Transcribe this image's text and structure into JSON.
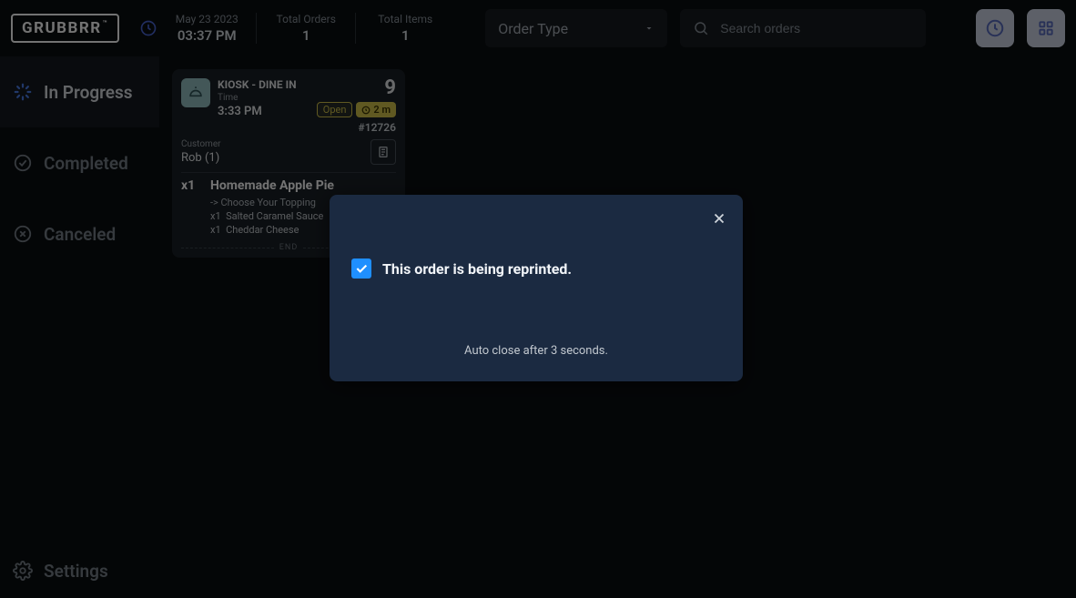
{
  "header": {
    "brand": "GRUBBRR",
    "tm": "™",
    "date": "May 23 2023",
    "time": "03:37 PM",
    "total_orders_label": "Total Orders",
    "total_orders_value": "1",
    "total_items_label": "Total Items",
    "total_items_value": "1",
    "order_type_label": "Order Type",
    "search_placeholder": "Search orders"
  },
  "sidebar": {
    "items": [
      {
        "label": "In Progress"
      },
      {
        "label": "Completed"
      },
      {
        "label": "Canceled"
      },
      {
        "label": "Settings"
      }
    ]
  },
  "order": {
    "source": "KIOSK - DINE IN",
    "time_label": "Time",
    "time": "3:33 PM",
    "number": "9",
    "status_open": "Open",
    "timer": "2 m",
    "order_id": "#12726",
    "customer_label": "Customer",
    "customer": "Rob (1)",
    "item_qty": "x1",
    "item_name": "Homemade Apple Pie",
    "mod_header": "-> Choose Your Topping",
    "mod1_qty": "x1",
    "mod1_name": "Salted Caramel Sauce",
    "mod2_qty": "x1",
    "mod2_name": "Cheddar Cheese",
    "end_label": "END"
  },
  "modal": {
    "message": "This order is being reprinted.",
    "auto_close": "Auto close after 3 seconds."
  }
}
